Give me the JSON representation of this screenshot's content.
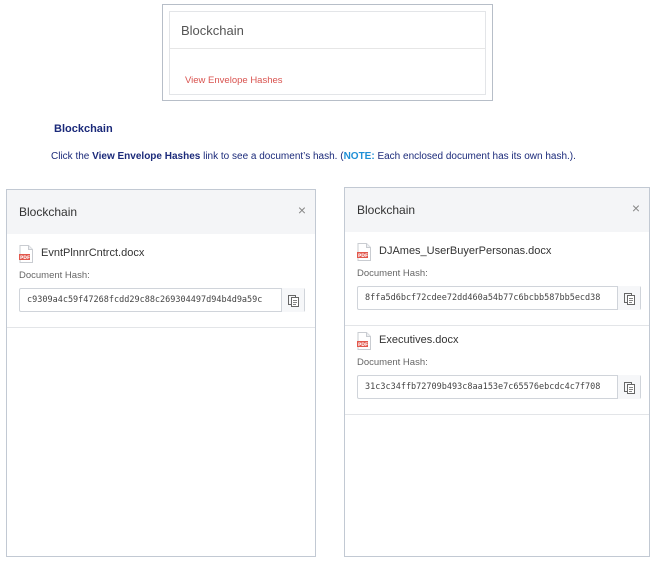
{
  "snippet": {
    "title": "Blockchain",
    "link": "View Envelope Hashes"
  },
  "section": {
    "heading": "Blockchain",
    "instruction": {
      "prefix": "Click the ",
      "link_name": "View Envelope Hashes",
      "middle": " link to see a document’s hash. (",
      "note_label": "NOTE:",
      "suffix": " Each enclosed document has its own hash.)."
    }
  },
  "panels": [
    {
      "title": "Blockchain",
      "close": "×",
      "documents": [
        {
          "name": "EvntPlnnrCntrct.docx",
          "hash_label": "Document Hash:",
          "hash": "c9309a4c59f47268fcdd29c88c269304497d94b4d9a59c"
        }
      ]
    },
    {
      "title": "Blockchain",
      "close": "×",
      "documents": [
        {
          "name": "DJAmes_UserBuyerPersonas.docx",
          "hash_label": "Document Hash:",
          "hash": "8ffa5d6bcf72cdee72dd460a54b77c6bcbb587bb5ecd38"
        },
        {
          "name": "Executives.docx",
          "hash_label": "Document Hash:",
          "hash": "31c3c34ffb72709b493c8aa153e7c65576ebcdc4c7f708"
        }
      ]
    }
  ],
  "colors": {
    "link": "#d9534f",
    "heading": "#1b2a7a",
    "note": "#1f8fd6",
    "pdf": "#e2574c"
  }
}
